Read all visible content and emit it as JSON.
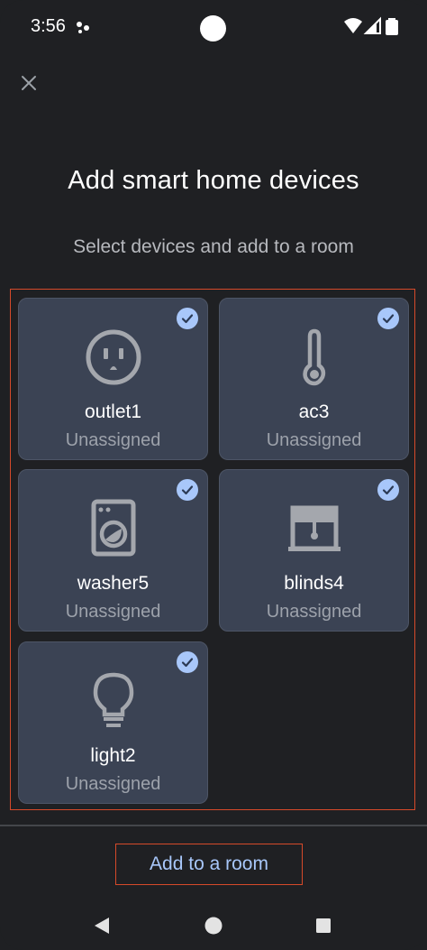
{
  "status_bar": {
    "time": "3:56",
    "icons": [
      "assistant-dots-icon",
      "wifi-icon",
      "cell-signal-icon",
      "battery-icon"
    ]
  },
  "header": {
    "close_icon": "close-icon",
    "title": "Add smart home devices",
    "subtitle": "Select devices and add to a room"
  },
  "devices": [
    {
      "name": "outlet1",
      "room": "Unassigned",
      "icon": "outlet-icon",
      "selected": true
    },
    {
      "name": "ac3",
      "room": "Unassigned",
      "icon": "thermometer-icon",
      "selected": true
    },
    {
      "name": "washer5",
      "room": "Unassigned",
      "icon": "washer-icon",
      "selected": true
    },
    {
      "name": "blinds4",
      "room": "Unassigned",
      "icon": "blinds-icon",
      "selected": true
    },
    {
      "name": "light2",
      "room": "Unassigned",
      "icon": "lightbulb-icon",
      "selected": true
    }
  ],
  "footer": {
    "add_button_label": "Add to a room"
  },
  "nav_bar": {
    "icons": [
      "back-icon",
      "home-icon",
      "recents-icon"
    ]
  },
  "colors": {
    "background": "#1f2023",
    "card": "#3b4354",
    "check": "#a8c7fa",
    "accent_text": "#a8c7fa",
    "highlight_outline": "#d64a2a"
  }
}
